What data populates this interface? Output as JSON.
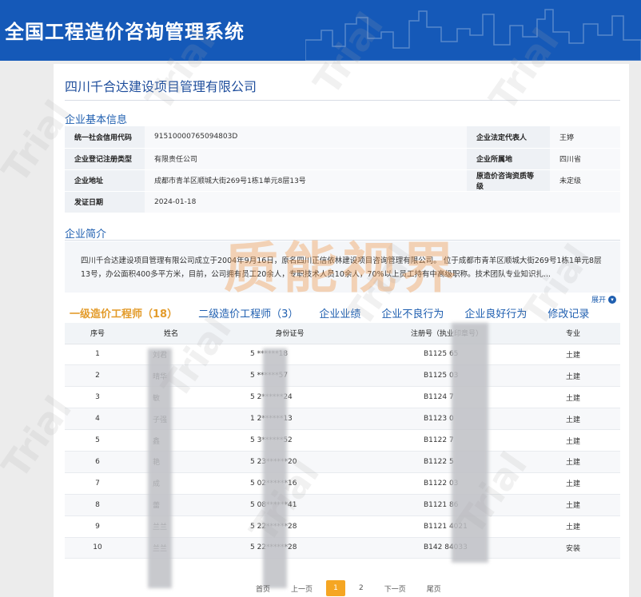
{
  "system": {
    "title": "全国工程造价咨询管理系统"
  },
  "company": {
    "name": "四川千合达建设项目管理有限公司"
  },
  "basic_info": {
    "title": "企业基本信息",
    "rows": [
      {
        "k1": "统一社会信用代码",
        "v1": "91510000765094803D",
        "k2": "企业法定代表人",
        "v2": "王婷"
      },
      {
        "k1": "企业登记注册类型",
        "v1": "有限责任公司",
        "k2": "企业所属地",
        "v2": "四川省"
      },
      {
        "k1": "企业地址",
        "v1": "成都市青羊区顺城大街269号1栋1单元8层13号",
        "k2": "原造价咨询资质等级",
        "v2": "未定级"
      },
      {
        "k1": "发证日期",
        "v1": "2024-01-18",
        "k2": "",
        "v2": ""
      }
    ]
  },
  "intro": {
    "title": "企业简介",
    "text": "四川千合达建设项目管理有限公司成立于2004年9月16日，原名四川正信依林建设项目咨询管理有限公司。 位于成都市青羊区顺城大街269号1栋1单元8层13号，办公面积400多平方米，目前，公司拥有员工20余人，专职技术人员10余人，70%以上员工持有中高级职称。技术团队专业知识扎...",
    "expand": "展开"
  },
  "tabs": [
    {
      "label": "一级造价工程师（18）",
      "active": true
    },
    {
      "label": "二级造价工程师（3）"
    },
    {
      "label": "企业业绩"
    },
    {
      "label": "企业不良行为"
    },
    {
      "label": "企业良好行为"
    },
    {
      "label": "修改记录"
    }
  ],
  "staff": {
    "headers": [
      "序号",
      "姓名",
      "身份证号",
      "注册号（执业印章号）",
      "专业"
    ],
    "rows": [
      {
        "no": "1",
        "name": "刘君",
        "id": "5 ******18",
        "reg": "B1125 65",
        "spec": "土建"
      },
      {
        "no": "2",
        "name": "晴华",
        "id": "5 ******57",
        "reg": "B1125 03",
        "spec": "土建"
      },
      {
        "no": "3",
        "name": "敏",
        "id": "5 2******24",
        "reg": "B1124 7",
        "spec": "土建"
      },
      {
        "no": "4",
        "name": "子强",
        "id": "1 2******13",
        "reg": "B1123 0",
        "spec": "土建"
      },
      {
        "no": "5",
        "name": "鑫",
        "id": "5 3******52",
        "reg": "B1122 7",
        "spec": "土建"
      },
      {
        "no": "6",
        "name": "艳",
        "id": "5 23******20",
        "reg": "B1122 5",
        "spec": "土建"
      },
      {
        "no": "7",
        "name": "成",
        "id": "5 02******16",
        "reg": "B1122 03",
        "spec": "土建"
      },
      {
        "no": "8",
        "name": "蕾",
        "id": "5 08******41",
        "reg": "B1121 86",
        "spec": "土建"
      },
      {
        "no": "9",
        "name": "兰兰",
        "id": "5 22******28",
        "reg": "B1121 4021",
        "spec": "土建"
      },
      {
        "no": "10",
        "name": "兰兰",
        "id": "5 22******28",
        "reg": "B142 84033",
        "spec": "安装"
      }
    ]
  },
  "pager": {
    "first": "首页",
    "prev": "上一页",
    "current": "1",
    "next_num": "2",
    "next": "下一页",
    "last": "尾页"
  },
  "watermark": {
    "big": "质能视界",
    "small": "Trial"
  }
}
